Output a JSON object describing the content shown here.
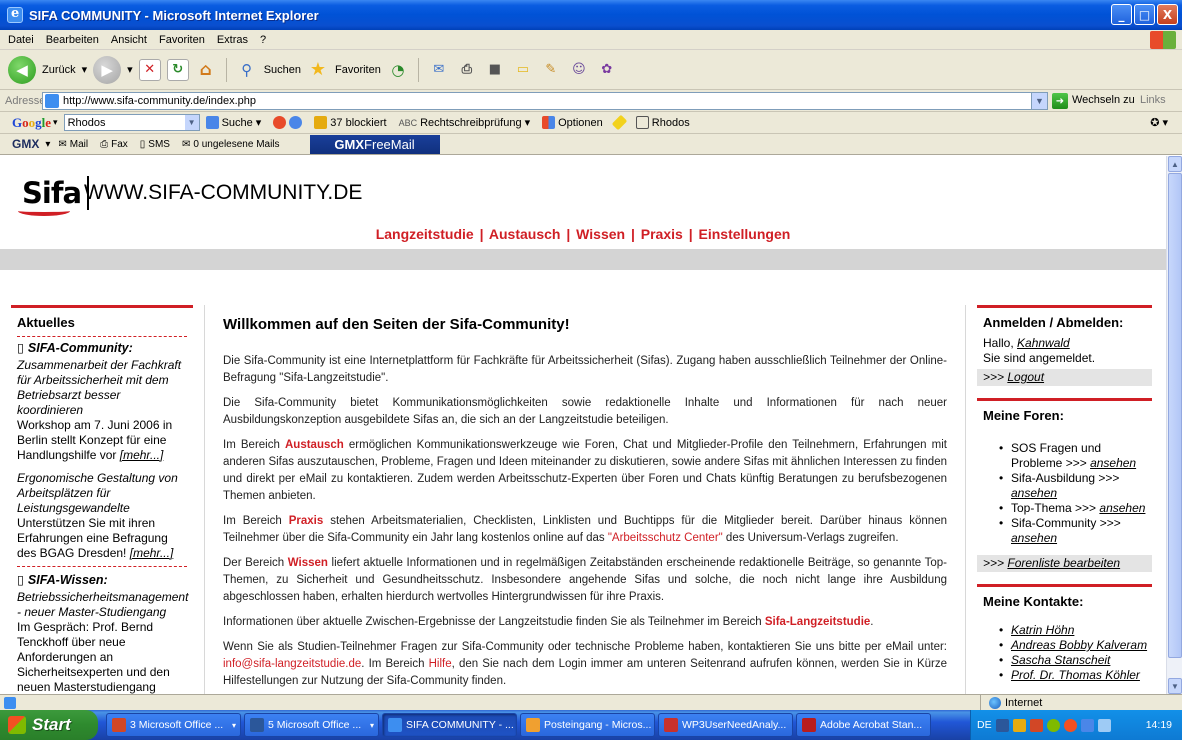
{
  "window": {
    "title": "SIFA COMMUNITY - Microsoft Internet Explorer",
    "buttons": {
      "minimize": "_",
      "maximize": "□",
      "close": "X"
    }
  },
  "menubar": [
    "Datei",
    "Bearbeiten",
    "Ansicht",
    "Favoriten",
    "Extras",
    "?"
  ],
  "toolbar": {
    "back_label": "Zurück",
    "search_label": "Suchen",
    "favorites_label": "Favoriten"
  },
  "addressbar": {
    "label": "Adresse",
    "url": "http://www.sifa-community.de/index.php",
    "go_label": "Wechseln zu",
    "links_label": "Links"
  },
  "googlebar": {
    "search_value": "Rhodos",
    "suche_label": "Suche",
    "blocked_label": "37 blockiert",
    "spell_label": "Rechtschreibprüfung",
    "options_label": "Optionen",
    "rhodos_label": "Rhodos"
  },
  "gmxbar": {
    "mail_label": "Mail",
    "fax_label": "Fax",
    "sms_label": "SMS",
    "unread_label": "0 ungelesene Mails",
    "freemail_bold": "GMX",
    "freemail_rest": "FreeMail"
  },
  "site": {
    "logo_text": "Sifa",
    "url_text": "WWW.SIFA-COMMUNITY.DE",
    "nav": [
      "Langzeitstudie",
      "Austausch",
      "Wissen",
      "Praxis",
      "Einstellungen"
    ]
  },
  "left": {
    "heading": "Aktuelles",
    "sections": [
      {
        "category": "SIFA-Community:",
        "items": [
          {
            "headline": "Zusammenarbeit der Fachkraft für Arbeitssicherheit mit dem Betriebsarzt besser koordinieren",
            "body": "Workshop am 7. Juni 2006 in Berlin stellt Konzept für eine Handlungshilfe vor",
            "more": "[mehr...]"
          },
          {
            "headline": "Ergonomische Gestaltung von Arbeitsplätzen für Leistungsgewandelte",
            "body": "Unterstützen Sie mit ihren Erfahrungen eine Befragung des BGAG Dresden!",
            "more": "[mehr...]"
          }
        ]
      },
      {
        "category": "SIFA-Wissen:",
        "items": [
          {
            "headline": "Betriebssicherheitsmanagement - neuer Master-Studiengang",
            "body": "Im Gespräch: Prof. Bernd Tenckhoff über neue Anforderungen an Sicherheitsexperten und den neuen Masterstudiengang",
            "more": ""
          }
        ]
      }
    ]
  },
  "main": {
    "title": "Willkommen auf den Seiten der Sifa-Community!",
    "p1": "Die Sifa-Community ist eine Internetplattform für Fachkräfte für Arbeitssicherheit (Sifas). Zugang haben ausschließlich Teilnehmer der Online-Befragung \"Sifa-Langzeitstudie\".",
    "p2": "Die Sifa-Community bietet Kommunikationsmöglichkeiten sowie redaktionelle Inhalte und Informationen für nach neuer Ausbildungskonzeption ausgebildete Sifas an, die sich an der Langzeitstudie beteiligen.",
    "p3": {
      "pre": "Im Bereich ",
      "kw": "Austausch",
      "post": " ermöglichen Kommunikationswerkzeuge wie Foren, Chat und Mitglieder-Profile den Teilnehmern, Erfahrungen mit anderen Sifas auszutauschen, Probleme, Fragen und Ideen miteinander zu diskutieren, sowie andere Sifas mit ähnlichen Interessen zu finden und direkt per eMail zu kontaktieren. Zudem werden Arbeitsschutz-Experten über Foren und Chats künftig Beratungen zu berufsbezogenen Themen anbieten."
    },
    "p4": {
      "pre": "Im Bereich ",
      "kw": "Praxis",
      "mid": " stehen Arbeitsmaterialien, Checklisten, Linklisten und Buchtipps für die Mitglieder bereit. Darüber hinaus können Teilnehmer über die Sifa-Community ein Jahr lang kostenlos online auf das ",
      "link": "\"Arbeitsschutz Center\"",
      "post": " des Universum-Verlags zugreifen."
    },
    "p5": {
      "pre": "Der Bereich ",
      "kw": "Wissen",
      "post": " liefert aktuelle Informationen und in regelmäßigen Zeitabständen erscheinende redaktionelle Beiträge, so genannte Top-Themen, zu Sicherheit und Gesundheitsschutz. Insbesondere angehende Sifas und solche, die noch nicht lange ihre Ausbildung abgeschlossen haben, erhalten hierdurch wertvolles Hintergrundwissen für ihre Praxis."
    },
    "p6": {
      "pre": "Informationen über aktuelle Zwischen-Ergebnisse der Langzeitstudie finden Sie als Teilnehmer im Bereich ",
      "kw": "Sifa-Langzeitstudie",
      "post": "."
    },
    "p7": {
      "pre": "Wenn Sie als Studien-Teilnehmer Fragen zur Sifa-Community oder technische Probleme haben, kontaktieren Sie uns bitte per eMail unter: ",
      "email": "info@sifa-langzeitstudie.de",
      "mid": ". Im Bereich ",
      "help": "Hilfe",
      "post": ", den Sie nach dem Login immer am unteren Seitenrand aufrufen können, werden Sie in Kürze Hilfestellungen zur Nutzung der Sifa-Community finden."
    }
  },
  "right": {
    "login": {
      "heading": "Anmelden / Abmelden:",
      "greeting": "Hallo, ",
      "username": "Kahnwald",
      "status": "Sie sind angemeldet.",
      "logout_prefix": ">>> ",
      "logout": "Logout"
    },
    "forums": {
      "heading": "Meine Foren:",
      "items": [
        {
          "name": "SOS Fragen und Probleme >>> ",
          "link": "ansehen"
        },
        {
          "name": "Sifa-Ausbildung >>> ",
          "link": "ansehen"
        },
        {
          "name": "Top-Thema >>> ",
          "link": "ansehen"
        },
        {
          "name": "Sifa-Community >>> ",
          "link": "ansehen"
        }
      ],
      "edit_prefix": ">>> ",
      "edit": "Forenliste bearbeiten"
    },
    "contacts": {
      "heading": "Meine Kontakte:",
      "items": [
        "Katrin Höhn",
        "Andreas Bobby Kalveram",
        "Sascha Stanscheit",
        "Prof. Dr. Thomas Köhler"
      ]
    }
  },
  "statusbar": {
    "zone": "Internet"
  },
  "taskbar": {
    "start": "Start",
    "tasks": [
      {
        "label": "3 Microsoft Office ...",
        "color": "#d24726",
        "active": false,
        "arrow": true
      },
      {
        "label": "5 Microsoft Office ...",
        "color": "#2b579a",
        "active": false,
        "arrow": true
      },
      {
        "label": "SIFA COMMUNITY - ...",
        "color": "#3d8ef0",
        "active": true,
        "arrow": false
      },
      {
        "label": "Posteingang - Micros...",
        "color": "#f0a030",
        "active": false,
        "arrow": false
      },
      {
        "label": "WP3UserNeedAnaly...",
        "color": "#c8312c",
        "active": false,
        "arrow": false
      },
      {
        "label": "Adobe Acrobat Stan...",
        "color": "#b81d1d",
        "active": false,
        "arrow": false
      }
    ],
    "tray_lang": "DE",
    "clock": "14:19"
  }
}
